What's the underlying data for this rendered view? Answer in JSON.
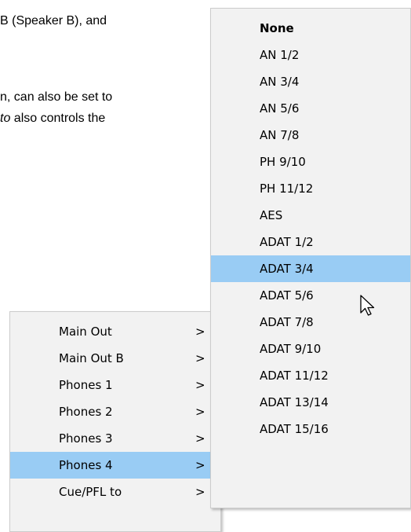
{
  "document": {
    "line1": "B (Speaker B), and",
    "line2": "n, can also be set to",
    "line3_italic": "to",
    "line3_rest": " also controls the"
  },
  "main_menu": {
    "items": [
      {
        "label": "Main Out",
        "arrow": ">"
      },
      {
        "label": "Main Out B",
        "arrow": ">"
      },
      {
        "label": "Phones 1",
        "arrow": ">"
      },
      {
        "label": "Phones 2",
        "arrow": ">"
      },
      {
        "label": "Phones 3",
        "arrow": ">"
      },
      {
        "label": "Phones 4",
        "arrow": ">"
      },
      {
        "label": "Cue/PFL to",
        "arrow": ">"
      }
    ],
    "highlighted": "Phones 4"
  },
  "submenu": {
    "items": [
      {
        "label": "None"
      },
      {
        "label": "AN 1/2"
      },
      {
        "label": "AN 3/4"
      },
      {
        "label": "AN 5/6"
      },
      {
        "label": "AN 7/8"
      },
      {
        "label": "PH 9/10"
      },
      {
        "label": "PH 11/12"
      },
      {
        "label": "AES"
      },
      {
        "label": "ADAT 1/2"
      },
      {
        "label": "ADAT 3/4"
      },
      {
        "label": "ADAT 5/6"
      },
      {
        "label": "ADAT 7/8"
      },
      {
        "label": "ADAT 9/10"
      },
      {
        "label": "ADAT 11/12"
      },
      {
        "label": "ADAT 13/14"
      },
      {
        "label": "ADAT 15/16"
      }
    ],
    "selected": "None",
    "highlighted": "ADAT 3/4"
  },
  "colors": {
    "menu_background": "#f2f2f2",
    "highlight": "#99ccf4",
    "border": "#cccccc"
  },
  "icons": {
    "cursor": "mouse-pointer-icon",
    "submenu_arrow": "chevron-right-icon"
  }
}
